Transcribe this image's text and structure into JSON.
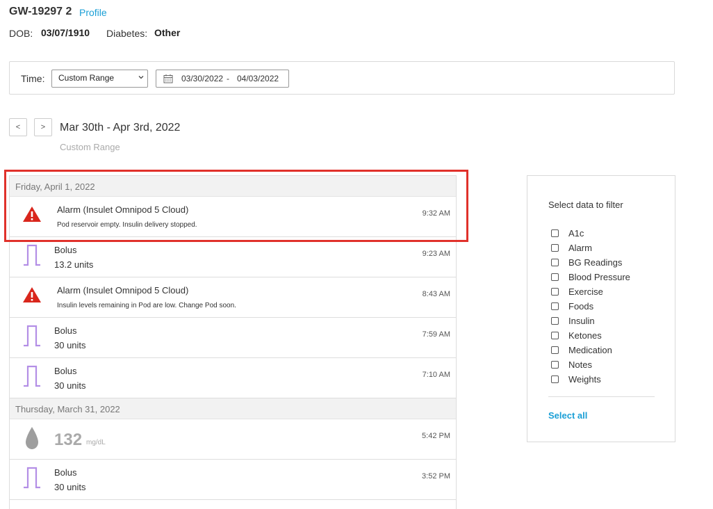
{
  "patient": {
    "id": "GW-19297 2",
    "profile_link": "Profile",
    "dob_label": "DOB:",
    "dob": "03/07/1910",
    "diabetes_label": "Diabetes:",
    "diabetes_type": "Other"
  },
  "time_filter": {
    "label": "Time:",
    "range_selected": "Custom Range",
    "start_date": "03/30/2022",
    "separator": "-",
    "end_date": "04/03/2022"
  },
  "period": {
    "prev": "<",
    "next": ">",
    "title": "Mar 30th - Apr 3rd, 2022",
    "subtitle": "Custom Range"
  },
  "log": {
    "days": [
      {
        "header": "Friday, April 1, 2022",
        "entries": [
          {
            "type": "alarm",
            "title": "Alarm (Insulet Omnipod 5 Cloud)",
            "message": "Pod reservoir empty. Insulin delivery stopped.",
            "time": "9:32 AM"
          },
          {
            "type": "bolus",
            "title": "Bolus",
            "amount": "13.2 units",
            "time": "9:23 AM"
          },
          {
            "type": "alarm",
            "title": "Alarm (Insulet Omnipod 5 Cloud)",
            "message": "Insulin levels remaining in Pod are low. Change Pod soon.",
            "time": "8:43 AM"
          },
          {
            "type": "bolus",
            "title": "Bolus",
            "amount": "30 units",
            "time": "7:59 AM"
          },
          {
            "type": "bolus",
            "title": "Bolus",
            "amount": "30 units",
            "time": "7:10 AM"
          }
        ]
      },
      {
        "header": "Thursday, March 31, 2022",
        "entries": [
          {
            "type": "bg",
            "value": "132",
            "unit": "mg/dL",
            "time": "5:42 PM"
          },
          {
            "type": "bolus",
            "title": "Bolus",
            "amount": "30 units",
            "time": "3:52 PM"
          }
        ]
      }
    ]
  },
  "filter": {
    "title": "Select data to filter",
    "options": [
      "A1c",
      "Alarm",
      "BG Readings",
      "Blood Pressure",
      "Exercise",
      "Foods",
      "Insulin",
      "Ketones",
      "Medication",
      "Notes",
      "Weights"
    ],
    "select_all": "Select all"
  },
  "colors": {
    "accent": "#1a9fd6",
    "alarm": "#d9261c",
    "bolus": "#b38ee6",
    "highlight": "#e0312b",
    "bg_drop": "#9e9e9e"
  }
}
